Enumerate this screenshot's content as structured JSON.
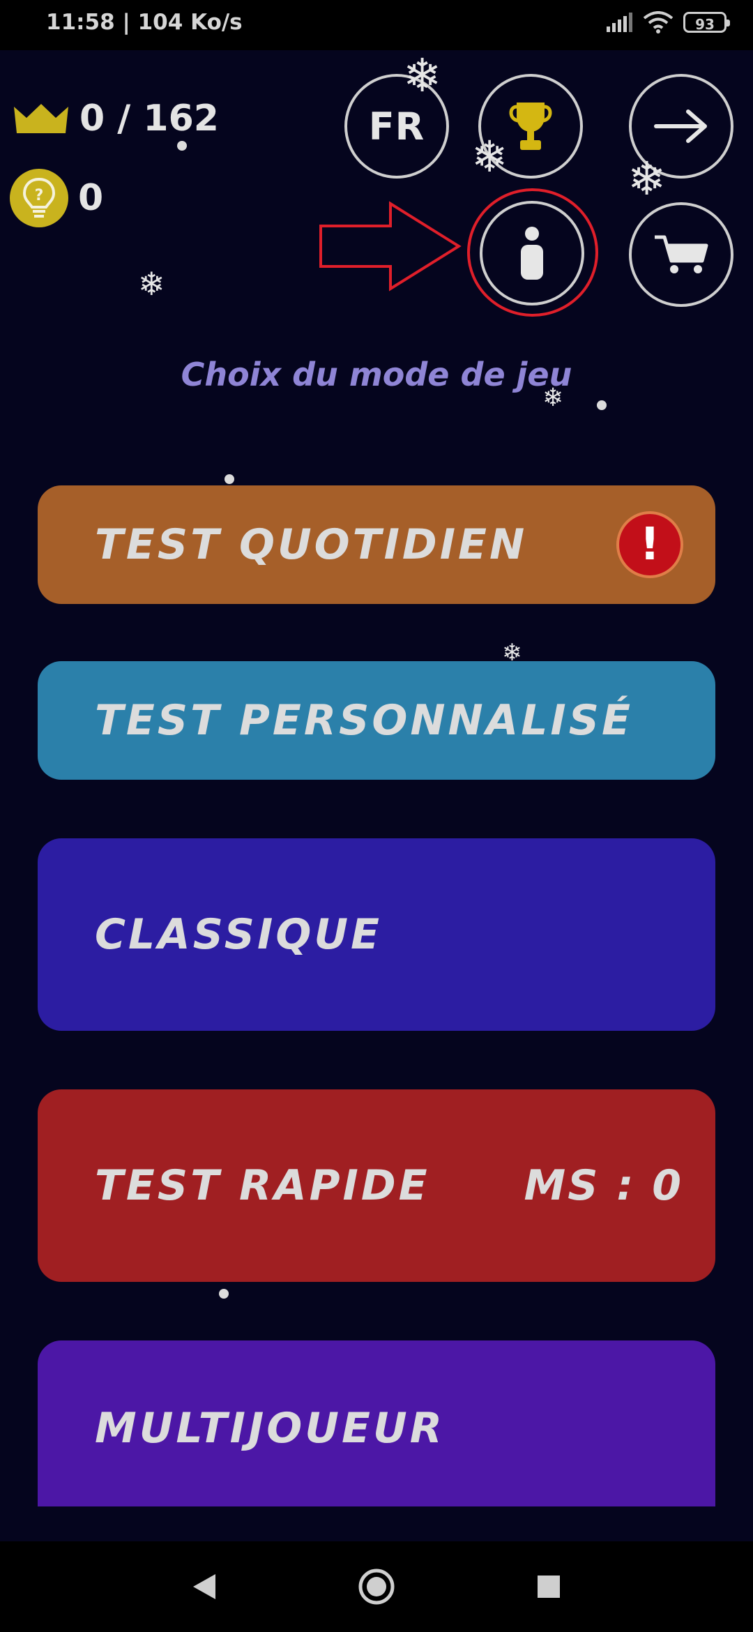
{
  "status_bar": {
    "time": "11:58 | 104 Ko/s",
    "battery": "93"
  },
  "counters": {
    "crowns": "0 / 162",
    "hints": "0"
  },
  "top_buttons": {
    "language": "FR"
  },
  "subtitle": "Choix du mode de jeu",
  "modes": [
    {
      "label": "TEST QUOTIDIEN",
      "badge": "!",
      "color": "#a65f29"
    },
    {
      "label": "TEST PERSONNALISÉ",
      "color": "#2b80aa"
    },
    {
      "label": "CLASSIQUE",
      "color": "#2c1da2"
    },
    {
      "label": "TEST RAPIDE",
      "score": "MS : 0",
      "color": "#a01f22"
    },
    {
      "label": "MULTIJOUEUR",
      "color": "#4c17a6"
    }
  ],
  "colors": {
    "background": "#05051e",
    "gold": "#c9b31e",
    "highlight": "#e01f2a"
  },
  "icons": [
    "crown-icon",
    "lightbulb-icon",
    "trophy-icon",
    "arrow-right-icon",
    "info-icon",
    "cart-icon",
    "snowflake-icon",
    "alert-icon"
  ]
}
